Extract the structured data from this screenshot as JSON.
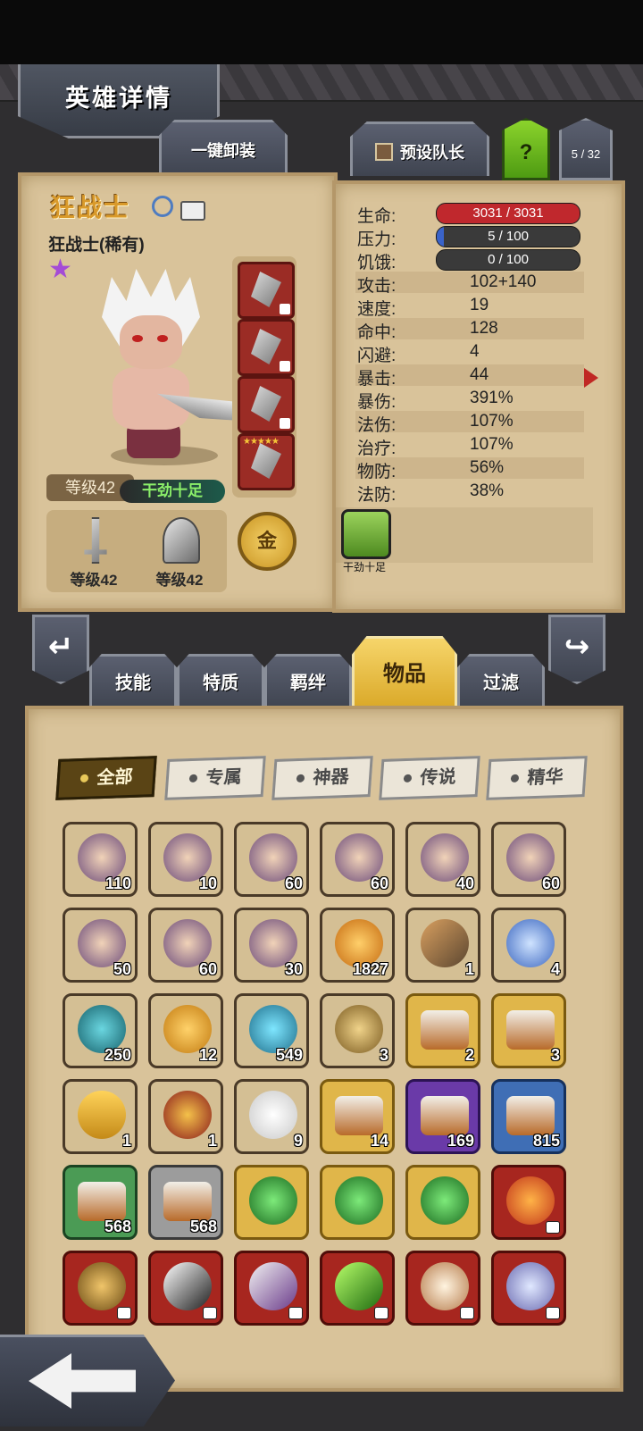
{
  "header": {
    "title": "英雄详情"
  },
  "toolbar": {
    "unequip_all": "一键卸装",
    "preset_captain": "预设队长",
    "help": "?",
    "page_counter": "5 / 32"
  },
  "hero": {
    "name": "狂战士",
    "class_rarity": "狂战士(稀有)",
    "level": "等级42",
    "status": "干劲十足",
    "weapon_level": "等级42",
    "armor_level": "等级42",
    "gold_badge": "金"
  },
  "stats": {
    "hp": {
      "label": "生命:",
      "value": "3031 / 3031",
      "fraction": 1.0,
      "color": "#c0282d"
    },
    "stress": {
      "label": "压力:",
      "value": "5 / 100",
      "fraction": 0.05,
      "color": "#3a63c9"
    },
    "hunger": {
      "label": "饥饿:",
      "value": "0 / 100",
      "fraction": 0.0,
      "color": "#8a8a8a"
    },
    "rows": [
      {
        "label": "攻击:",
        "value": "102+140"
      },
      {
        "label": "速度:",
        "value": "19"
      },
      {
        "label": "命中:",
        "value": "128"
      },
      {
        "label": "闪避:",
        "value": "4"
      },
      {
        "label": "暴击:",
        "value": "44"
      },
      {
        "label": "暴伤:",
        "value": "391%"
      },
      {
        "label": "法伤:",
        "value": "107%"
      },
      {
        "label": "治疗:",
        "value": "107%"
      },
      {
        "label": "物防:",
        "value": "56%"
      },
      {
        "label": "法防:",
        "value": "38%"
      }
    ],
    "trait_label": "干劲十足"
  },
  "tabs": [
    {
      "label": "技能"
    },
    {
      "label": "特质"
    },
    {
      "label": "羁绊"
    },
    {
      "label": "物品"
    },
    {
      "label": "过滤"
    }
  ],
  "filters": [
    {
      "label": "全部"
    },
    {
      "label": "专属"
    },
    {
      "label": "神器"
    },
    {
      "label": "传说"
    },
    {
      "label": "精华"
    }
  ],
  "items": [
    {
      "count": "110",
      "rarity": "portrait",
      "icon": "hero-portrait-icon"
    },
    {
      "count": "10",
      "rarity": "portrait",
      "icon": "hero-portrait-icon"
    },
    {
      "count": "60",
      "rarity": "portrait",
      "icon": "hero-portrait-icon"
    },
    {
      "count": "60",
      "rarity": "portrait",
      "icon": "hero-portrait-icon"
    },
    {
      "count": "40",
      "rarity": "portrait",
      "icon": "hero-portrait-icon"
    },
    {
      "count": "60",
      "rarity": "portrait",
      "icon": "hero-portrait-icon"
    },
    {
      "count": "50",
      "rarity": "portrait",
      "icon": "hero-portrait-icon"
    },
    {
      "count": "60",
      "rarity": "portrait",
      "icon": "hero-portrait-icon"
    },
    {
      "count": "30",
      "rarity": "portrait",
      "icon": "hero-portrait-icon"
    },
    {
      "count": "1827",
      "rarity": "plain",
      "icon": "amber-gem-icon"
    },
    {
      "count": "1",
      "rarity": "plain",
      "icon": "chisel-icon"
    },
    {
      "count": "4",
      "rarity": "plain",
      "icon": "crystal-pile-icon"
    },
    {
      "count": "250",
      "rarity": "plain",
      "icon": "rune-stone-icon"
    },
    {
      "count": "12",
      "rarity": "plain",
      "icon": "feather-quill-icon"
    },
    {
      "count": "549",
      "rarity": "plain",
      "icon": "potion-icon"
    },
    {
      "count": "3",
      "rarity": "plain",
      "icon": "medallion-icon"
    },
    {
      "count": "2",
      "rarity": "gold",
      "icon": "chest-icon"
    },
    {
      "count": "3",
      "rarity": "gold",
      "icon": "chest-icon"
    },
    {
      "count": "1",
      "rarity": "plain",
      "icon": "ticket-icon"
    },
    {
      "count": "1",
      "rarity": "plain",
      "icon": "pirate-icon"
    },
    {
      "count": "9",
      "rarity": "plain",
      "icon": "white-feather-icon"
    },
    {
      "count": "14",
      "rarity": "gold",
      "icon": "chest-icon"
    },
    {
      "count": "169",
      "rarity": "purple",
      "icon": "chest-icon"
    },
    {
      "count": "815",
      "rarity": "blue",
      "icon": "chest-icon"
    },
    {
      "count": "568",
      "rarity": "green",
      "icon": "chest-icon"
    },
    {
      "count": "568",
      "rarity": "gray",
      "icon": "chest-icon"
    },
    {
      "count": "",
      "rarity": "gold",
      "icon": "green-orb-icon"
    },
    {
      "count": "",
      "rarity": "gold",
      "icon": "green-orb-icon"
    },
    {
      "count": "",
      "rarity": "gold",
      "icon": "green-orb-icon"
    },
    {
      "count": "",
      "rarity": "red",
      "icon": "fire-heart-icon",
      "locked": true
    },
    {
      "count": "",
      "rarity": "red",
      "icon": "hood-icon",
      "locked": true
    },
    {
      "count": "",
      "rarity": "red",
      "icon": "dagger-icon",
      "locked": true
    },
    {
      "count": "",
      "rarity": "red",
      "icon": "sword-icon",
      "locked": true
    },
    {
      "count": "",
      "rarity": "red",
      "icon": "green-blade-icon",
      "locked": true
    },
    {
      "count": "",
      "rarity": "red",
      "icon": "horn-icon",
      "locked": true
    },
    {
      "count": "",
      "rarity": "red",
      "icon": "crystal-ring-icon",
      "locked": true
    }
  ]
}
